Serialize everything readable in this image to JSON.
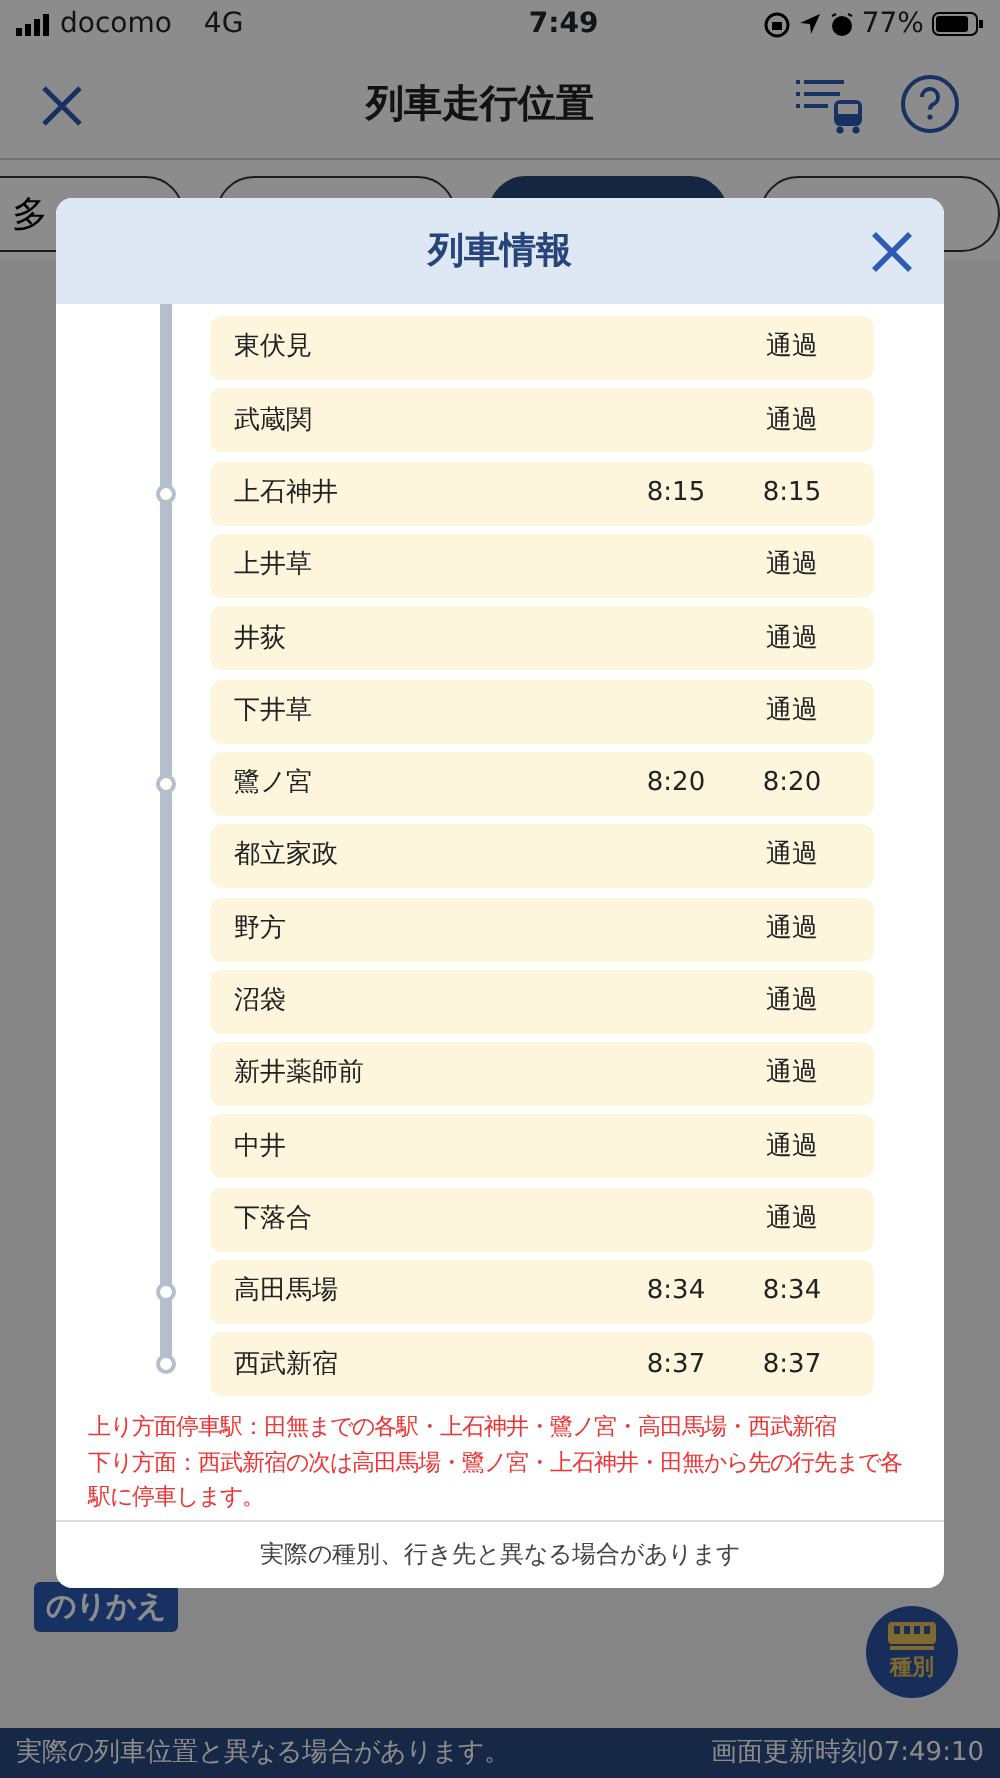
{
  "status_bar": {
    "carrier": "docomo",
    "network": "4G",
    "time": "7:49",
    "battery": "77%"
  },
  "header": {
    "title": "列車走行位置"
  },
  "tabs": [
    {
      "label": "多",
      "selected": false
    },
    {
      "selected": false
    },
    {
      "selected": true
    },
    {
      "selected": false
    }
  ],
  "background": {
    "badge": "のりかえ",
    "fab_label": "種別"
  },
  "modal": {
    "title": "列車情報",
    "stations": [
      {
        "kind": "pass",
        "name": "東伏見",
        "status": "通過"
      },
      {
        "kind": "pass",
        "name": "武蔵関",
        "status": "通過"
      },
      {
        "kind": "stop",
        "name": "上石神井",
        "arrival": "8:15",
        "departure": "8:15"
      },
      {
        "kind": "pass",
        "name": "上井草",
        "status": "通過"
      },
      {
        "kind": "pass",
        "name": "井荻",
        "status": "通過"
      },
      {
        "kind": "pass",
        "name": "下井草",
        "status": "通過"
      },
      {
        "kind": "stop",
        "name": "鷺ノ宮",
        "arrival": "8:20",
        "departure": "8:20"
      },
      {
        "kind": "pass",
        "name": "都立家政",
        "status": "通過"
      },
      {
        "kind": "pass",
        "name": "野方",
        "status": "通過"
      },
      {
        "kind": "pass",
        "name": "沼袋",
        "status": "通過"
      },
      {
        "kind": "pass",
        "name": "新井薬師前",
        "status": "通過"
      },
      {
        "kind": "pass",
        "name": "中井",
        "status": "通過"
      },
      {
        "kind": "pass",
        "name": "下落合",
        "status": "通過"
      },
      {
        "kind": "stop",
        "name": "高田馬場",
        "arrival": "8:34",
        "departure": "8:34"
      },
      {
        "kind": "stop",
        "name": "西武新宿",
        "arrival": "8:37",
        "departure": "8:37"
      }
    ],
    "notes": [
      "上り方面停車駅：田無までの各駅・上石神井・鷺ノ宮・高田馬場・西武新宿",
      "下り方面：西武新宿の次は高田馬場・鷺ノ宮・上石神井・田無から先の行先まで各駅に停車します。"
    ],
    "footer": "実際の種別、行き先と異なる場合があります"
  },
  "bottom_bar": {
    "left": "実際の列車位置と異なる場合があります。",
    "right": "画面更新時刻07:49:10"
  }
}
